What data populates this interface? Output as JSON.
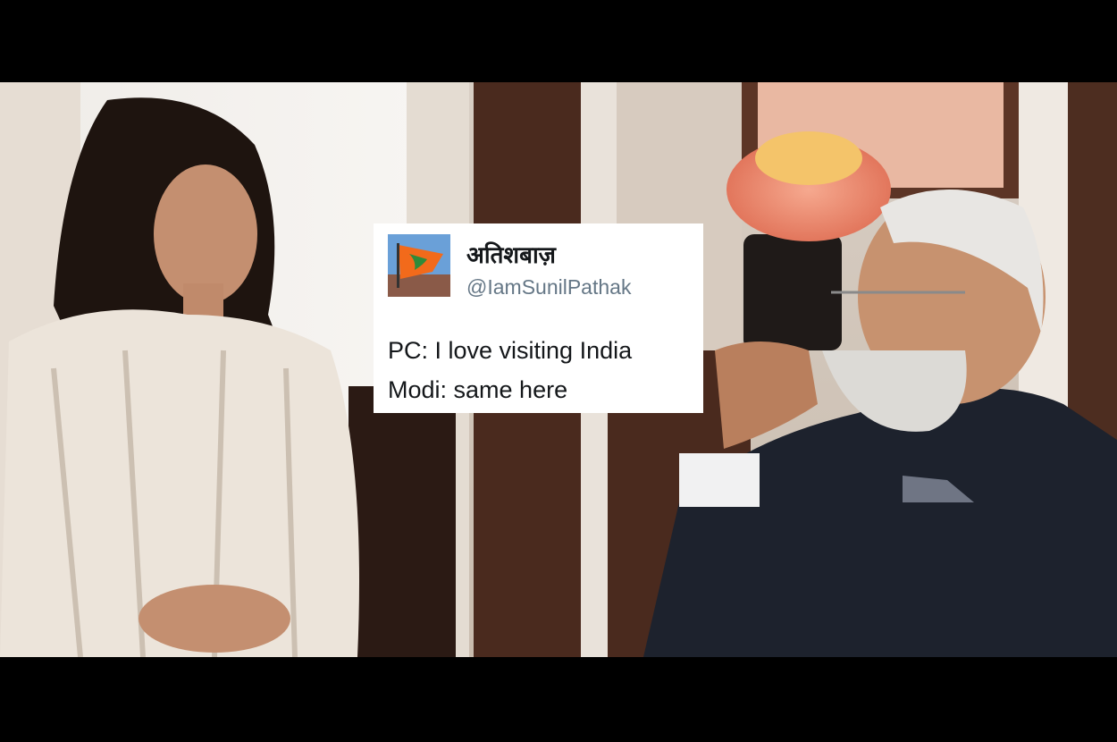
{
  "tweet": {
    "display_name": "अतिशबाज़",
    "handle": "@IamSunilPathak",
    "lines": [
      "PC: I love visiting India",
      "Modi: same here"
    ]
  },
  "colors": {
    "letterbox": "#000000",
    "card_background": "#ffffff",
    "name_color": "#14171a",
    "handle_color": "#657786"
  }
}
